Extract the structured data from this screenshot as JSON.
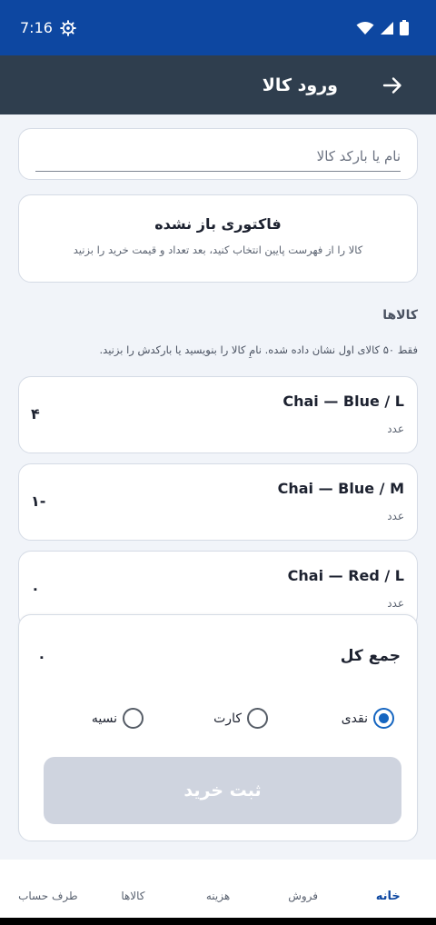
{
  "status_bar": {
    "time": "7:16"
  },
  "app_bar": {
    "title": "ورود کالا"
  },
  "search": {
    "placeholder": "نام یا بارکد کالا",
    "value": ""
  },
  "invoice": {
    "title": "فاکتوری باز نشده",
    "subtitle": "کالا را از فهرست پایین انتخاب کنید، بعد تعداد و قیمت خرید را بزنید"
  },
  "products": {
    "title": "کالاها",
    "hint": "فقط ۵۰ کالای اول نشان داده شده. نامِ کالا را بنویسید یا بارکدش را بزنید.",
    "items": [
      {
        "name": "Chai — Blue / L",
        "unit": "عدد",
        "qty": "۴"
      },
      {
        "name": "Chai — Blue / M",
        "unit": "عدد",
        "qty": "-۱"
      },
      {
        "name": "Chai — Red / L",
        "unit": "عدد",
        "qty": "۰"
      }
    ]
  },
  "checkout": {
    "total_label": "جمع کل",
    "total_value": "۰",
    "payment_methods": [
      {
        "label": "نقدی",
        "selected": true
      },
      {
        "label": "کارت",
        "selected": false
      },
      {
        "label": "نسیه",
        "selected": false
      }
    ],
    "submit_label": "ثبت خرید"
  },
  "bottom_nav": [
    {
      "label": "خانه",
      "active": true
    },
    {
      "label": "فروش",
      "active": false
    },
    {
      "label": "هزینه",
      "active": false
    },
    {
      "label": "کالاها",
      "active": false
    },
    {
      "label": "طرف حساب",
      "active": false
    }
  ],
  "colors": {
    "status_bar": "#0d47a1",
    "app_bar": "#2f3e4e",
    "accent": "#1565c0",
    "button_disabled": "#cfd4df"
  }
}
